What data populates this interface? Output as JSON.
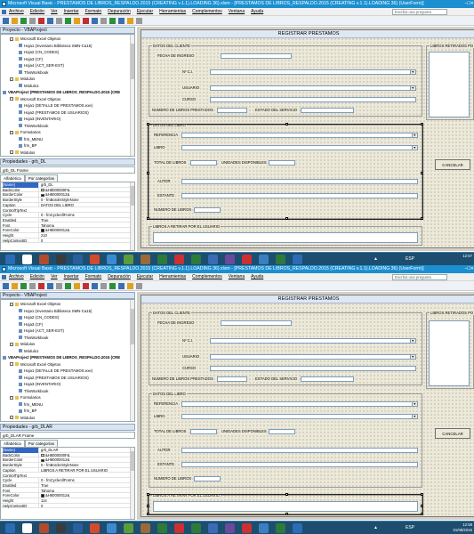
{
  "window": {
    "title": "Microsoft Visual Basic - PRESTAMOS DE LIBROS_RESPALDO.2015 (CREATING v.1.1).LOADING 36).xlsm - [PRESTAMOS DE LIBROS_RESPALDO.2015 (CREATING v.1.1).LOADING 36) (UserForm)]",
    "help_placeholder": "Escriba una pregunta"
  },
  "menu": [
    "Archivo",
    "Edición",
    "Ver",
    "Insertar",
    "Formato",
    "Depuración",
    "Ejecutar",
    "Herramientas",
    "Complementos",
    "Ventana",
    "Ayuda"
  ],
  "project": {
    "title": "Proyecto - VBAProject",
    "rows": [
      "Microsoft Excel Objetos",
      "Hoja1 (Inventario Biblioteca SMN-Ca15)",
      "Hoja2 (CN_CODES)",
      "Hoja3 (CF)",
      "Hoja4 (ACT_SER-EST)",
      "ThisWorkbook",
      "Módulos",
      "Módulo1",
      "VBAProject (PRESTAMOS DE LIBROS_RESPALDO.2015 (CRE",
      "Microsoft Excel Objetos",
      "Hoja1 (DETALLE DE PRESTAMOS.exe)",
      "Hoja2 (PRESTAMOS DE USUARIOS)",
      "Hoja3 (INVENTARIO)",
      "ThisWorkbook",
      "Formularios",
      "frm_MENU",
      "frm_BP",
      "Módulos"
    ]
  },
  "top": {
    "props_title": "Propiedades - grb_DL",
    "object": "grb_DL Frame",
    "tabs": [
      "Alfabética",
      "Por categorías"
    ],
    "props": [
      {
        "k": "(Name)",
        "v": "grb_DL"
      },
      {
        "k": "BackColor",
        "v": "&H8000000F&"
      },
      {
        "k": "BorderColor",
        "v": "&H80000012&"
      },
      {
        "k": "BorderStyle",
        "v": "0 - fmBorderStyleNone"
      },
      {
        "k": "Caption",
        "v": "DATOS DEL LIBRO"
      },
      {
        "k": "ControlTipText",
        "v": ""
      },
      {
        "k": "Cycle",
        "v": "0 - fmCycleAllForms"
      },
      {
        "k": "Enabled",
        "v": "True"
      },
      {
        "k": "Font",
        "v": "Tahoma"
      },
      {
        "k": "ForeColor",
        "v": "&H80000012&"
      },
      {
        "k": "Height",
        "v": "210"
      },
      {
        "k": "HelpContextID",
        "v": "0"
      }
    ],
    "clock_time": "12:57"
  },
  "bottom": {
    "props_title": "Propiedades - grb_DLAR",
    "object": "grb_DLAR Frame",
    "tabs": [
      "Alfabética",
      "Por categorías"
    ],
    "props": [
      {
        "k": "(Name)",
        "v": "grb_DLAR"
      },
      {
        "k": "BackColor",
        "v": "&H8000000F&"
      },
      {
        "k": "BorderColor",
        "v": "&H80000012&"
      },
      {
        "k": "BorderStyle",
        "v": "0 - fmBorderStyleNone"
      },
      {
        "k": "Caption",
        "v": "LIBROS A RETIRAR POR EL USUARIO"
      },
      {
        "k": "ControlTipText",
        "v": ""
      },
      {
        "k": "Cycle",
        "v": "0 - fmCycleAllForms"
      },
      {
        "k": "Enabled",
        "v": "True"
      },
      {
        "k": "Font",
        "v": "Tahoma"
      },
      {
        "k": "ForeColor",
        "v": "&H80000012&"
      },
      {
        "k": "Height",
        "v": "114"
      },
      {
        "k": "HelpContextID",
        "v": "0"
      }
    ],
    "clock_time": "12:58",
    "clock_date": "01/08/2015"
  },
  "form": {
    "title": "REGISTRAR PRESTAMOS",
    "cliente_caption": "DATOS DEL CLIENTE",
    "fecha_label": "FECHA DE INGRESO",
    "nci_label": "Nº C.I.",
    "usuario_label": "USUARIO",
    "curso_label": "CURSO",
    "num_libros_label": "NUMERO DE LIBROS PRESTADOS",
    "estado_label": "ESTADO DEL SERVICIO",
    "retirados_caption": "LIBROS RETIRADOS PO",
    "libro_caption": "DATOS DEL LIBRO",
    "referencia_label": "REFERENCIA",
    "libro_label": "LIBRO",
    "total_label": "TOTAL DE LIBROS",
    "unidades_label": "UNIDADES DISPONIBLES",
    "autor_label": "AUTOR",
    "estante_label": "ESTANTE",
    "numero_label": "NUMERO DE LIBROS",
    "cancelar_label": "CANCELAR",
    "retirar_caption": "LIBROS A RETIRAR POR EL USUARIO"
  },
  "taskbar": {
    "lang": "ESP"
  },
  "colors": {
    "titlebar": "#1c8fd0",
    "taskbar": "#1d4e6f",
    "selected": "#3167c4",
    "form_bg": "#ece9d8"
  }
}
